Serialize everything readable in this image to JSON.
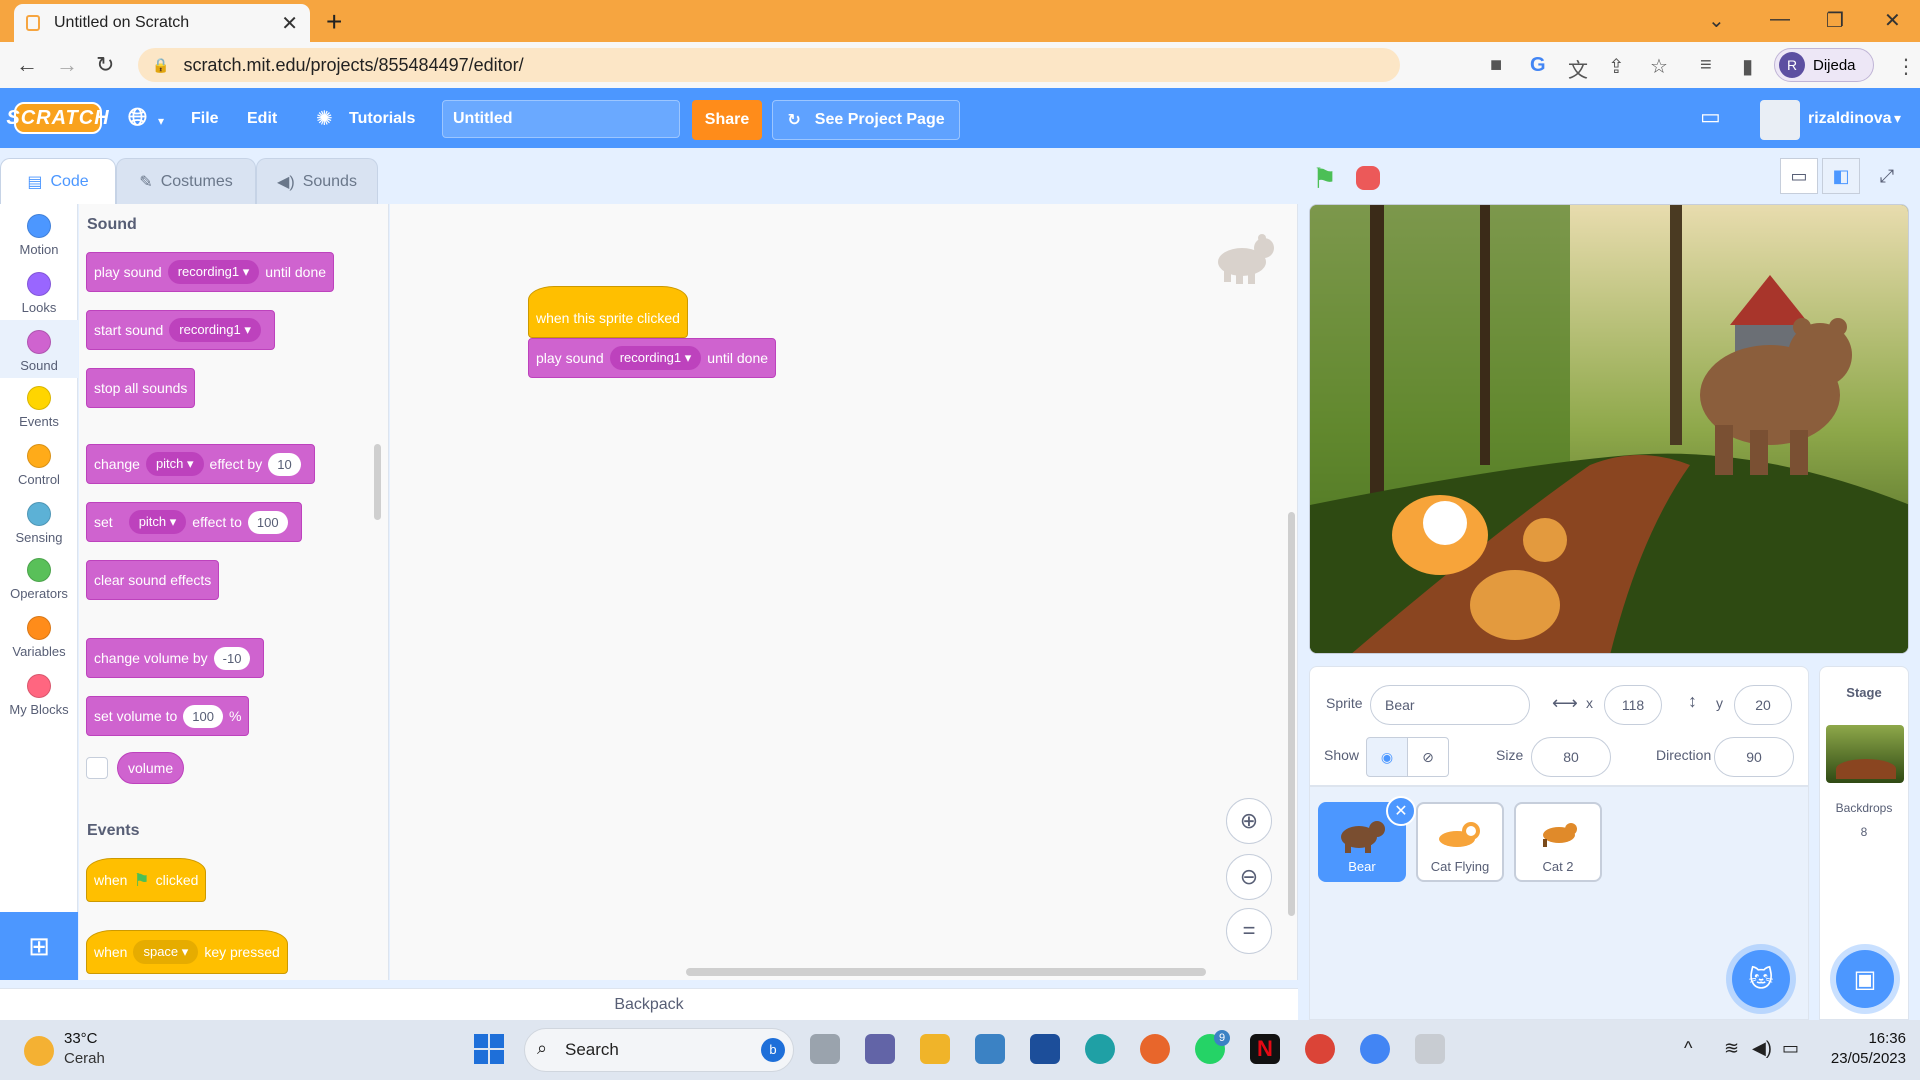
{
  "browser": {
    "tab_title": "Untitled on Scratch",
    "tab_close": "✕",
    "new_tab": "+",
    "url": "scratch.mit.edu/projects/855484497/editor/",
    "profile_initial": "R",
    "profile_name": "Dijeda"
  },
  "menu": {
    "logo": "SCRATCH",
    "file": "File",
    "edit": "Edit",
    "tutorials": "Tutorials",
    "project_title": "Untitled",
    "share": "Share",
    "see_project_page": "See Project Page",
    "username": "rizaldinova"
  },
  "tabs": {
    "code": "Code",
    "costumes": "Costumes",
    "sounds": "Sounds"
  },
  "categories": [
    {
      "label": "Motion",
      "color": "#4c97ff"
    },
    {
      "label": "Looks",
      "color": "#9966ff"
    },
    {
      "label": "Sound",
      "color": "#cf63cf"
    },
    {
      "label": "Events",
      "color": "#ffd500"
    },
    {
      "label": "Control",
      "color": "#ffab19"
    },
    {
      "label": "Sensing",
      "color": "#5cb1d6"
    },
    {
      "label": "Operators",
      "color": "#59c059"
    },
    {
      "label": "Variables",
      "color": "#ff8c1a"
    },
    {
      "label": "My Blocks",
      "color": "#ff6680"
    }
  ],
  "palette": {
    "sound_title": "Sound",
    "events_title": "Events",
    "play_sound": "play sound",
    "until_done": "until done",
    "recording": "recording1",
    "start_sound": "start sound",
    "stop_all": "stop all sounds",
    "change": "change",
    "pitch": "pitch",
    "effect_by": "effect by",
    "effect_by_val": "10",
    "set": "set",
    "effect_to": "effect to",
    "effect_to_val": "100",
    "clear_effects": "clear sound effects",
    "change_volume": "change volume by",
    "change_volume_val": "-10",
    "set_volume": "set volume to",
    "set_volume_val": "100",
    "percent": "%",
    "volume": "volume",
    "when": "when",
    "clicked": "clicked",
    "space": "space",
    "key_pressed": "key pressed"
  },
  "script": {
    "hat": "when this sprite clicked",
    "play_sound": "play sound",
    "recording": "recording1",
    "until_done": "until done"
  },
  "backpack": "Backpack",
  "sprite_info": {
    "sprite_label": "Sprite",
    "sprite_name": "Bear",
    "x_label": "x",
    "x": "118",
    "y_label": "y",
    "y": "20",
    "show_label": "Show",
    "size_label": "Size",
    "size": "80",
    "direction_label": "Direction",
    "direction": "90"
  },
  "sprites": [
    {
      "name": "Bear",
      "selected": true
    },
    {
      "name": "Cat Flying",
      "selected": false
    },
    {
      "name": "Cat 2",
      "selected": false
    }
  ],
  "stage_panel": {
    "title": "Stage",
    "backdrops_label": "Backdrops",
    "backdrops_count": "8"
  },
  "taskbar": {
    "temp": "33°C",
    "weather": "Cerah",
    "search": "Search",
    "whatsapp_badge": "9",
    "time": "16:36",
    "date": "23/05/2023"
  }
}
